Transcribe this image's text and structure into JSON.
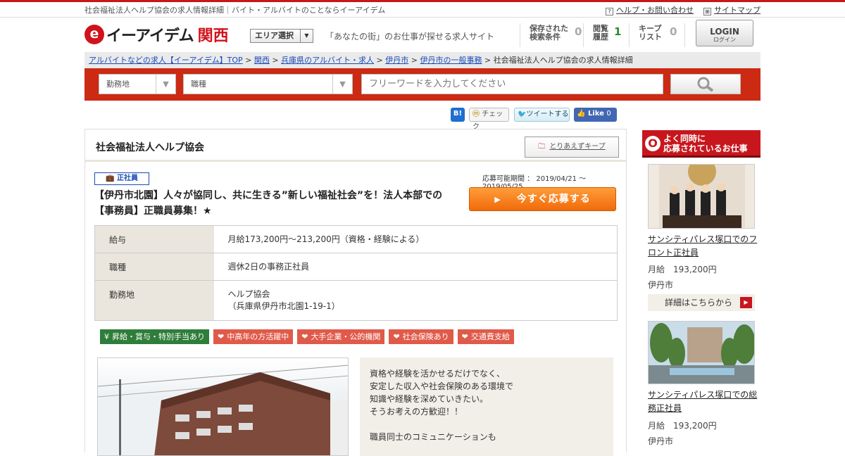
{
  "topbar": {
    "title": "社会福祉法人ヘルプ協会の求人情報詳細｜バイト・アルバイトのことならイーアイデム",
    "help": "ヘルプ・お問い合わせ",
    "sitemap": "サイトマップ"
  },
  "header": {
    "logo_name": "イーアイデム",
    "logo_region": "関西",
    "area_select": "エリア選択",
    "tagline": "「あなたの街」のお仕事が探せる求人サイト",
    "saved_label_1": "保存された",
    "saved_label_2": "検索条件",
    "saved_count": "0",
    "history_label_1": "閲覧",
    "history_label_2": "履歴",
    "history_count": "1",
    "keep_label_1": "キープ",
    "keep_label_2": "リスト",
    "keep_count": "0",
    "login": "LOGIN",
    "login_sub": "ログイン"
  },
  "breadcrumb": {
    "items": [
      "アルバイトなどの求人【イーアイデム】TOP",
      "関西",
      "兵庫県のアルバイト・求人",
      "伊丹市",
      "伊丹市の一般事務"
    ],
    "current": "社会福祉法人ヘルプ協会の求人情報詳細",
    "sep": " > "
  },
  "search": {
    "location": "勤務地",
    "job_type": "職種",
    "placeholder": "フリーワードを入力してください"
  },
  "social": {
    "hatena": "B!",
    "mixi": "チェック",
    "tweet": "ツイートする",
    "like": "Like",
    "like_count": "0"
  },
  "job": {
    "company": "社会福祉法人ヘルプ協会",
    "keep": "とりあえずキープ",
    "employment": "正社員",
    "period": "応募可能期間 ： 2019/04/21 ～ 2019/05/25",
    "title": "【伊丹市北園】人々が協同し、共に生きる”新しい福祉社会”を！法人本部での【事務員】正職員募集！★",
    "apply": "今すぐ応募する",
    "rows": [
      {
        "label": "給与",
        "value": "月給173,200円〜213,200円（資格・経験による）"
      },
      {
        "label": "職種",
        "value": "週休2日の事務正社員"
      },
      {
        "label": "勤務地",
        "value": "ヘルプ協会",
        "value2": "（兵庫県伊丹市北園1-19-1）"
      }
    ],
    "tags": [
      {
        "label": "昇給・賞与・特別手当あり",
        "icon": "¥"
      },
      {
        "label": "中高年の方活躍中",
        "icon": "❤"
      },
      {
        "label": "大手企業・公的機関",
        "icon": "❤"
      },
      {
        "label": "社会保険あり",
        "icon": "❤"
      },
      {
        "label": "交通費支給",
        "icon": "❤"
      }
    ],
    "description": "資格や経験を活かせるだけでなく、\n安定した収入や社会保険のある環境で\n知識や経験を深めていきたい。\nそうお考えの方歓迎！！\n\n職員同士のコミュニケーションも"
  },
  "sidebar": {
    "heading_1": "よく同時に",
    "heading_2": "応募されているお仕事",
    "items": [
      {
        "title": "サンシティパレス塚口でのフロント正社員",
        "salary": "月給　193,200円",
        "location": "伊丹市",
        "detail": "詳細はこちらから"
      },
      {
        "title": "サンシティパレス塚口での総務正社員",
        "salary": "月給　193,200円",
        "location": "伊丹市"
      }
    ]
  },
  "colors": {
    "brand_red": "#c8161d",
    "apply_orange": "#f16a0a",
    "link_blue": "#1a4ab8"
  }
}
